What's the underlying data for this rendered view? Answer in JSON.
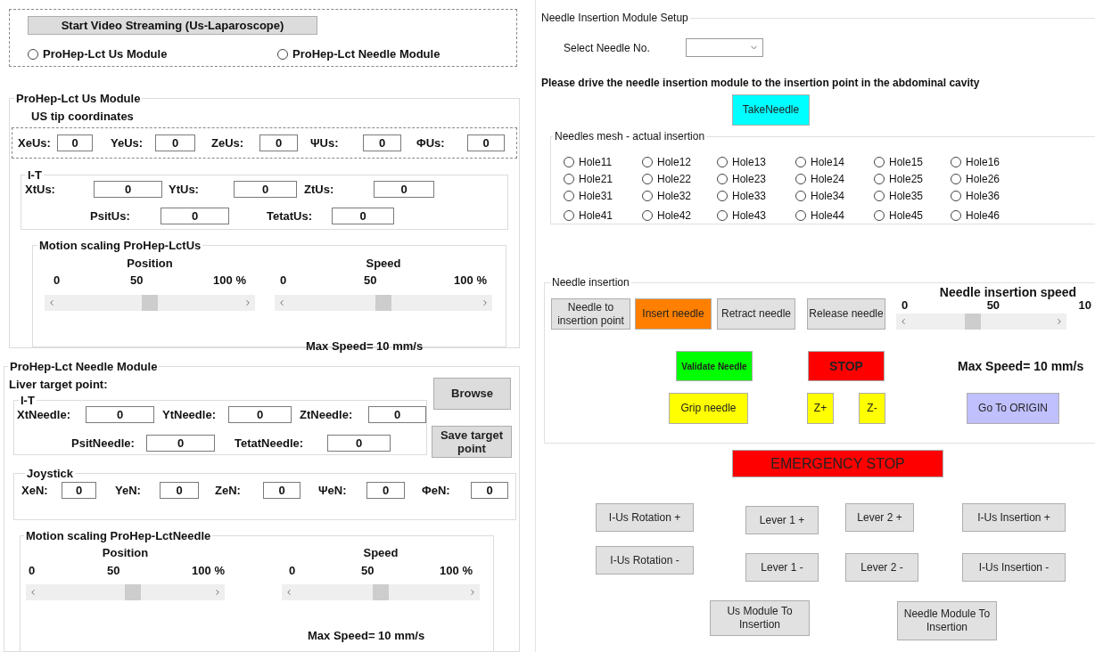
{
  "video_panel": {
    "stream_button": "Start Video  Streaming (Us-Laparoscope)",
    "modules": [
      {
        "label": "ProHep-Lct Us Module",
        "selected": false
      },
      {
        "label": "ProHep-Lct Needle Module",
        "selected": false
      }
    ]
  },
  "us_module": {
    "title": "ProHep-Lct Us Module",
    "tip_title": "US tip coordinates",
    "tip_fields": [
      {
        "label": "XeUs:",
        "value": "0"
      },
      {
        "label": "YeUs:",
        "value": "0"
      },
      {
        "label": "ZeUs:",
        "value": "0"
      },
      {
        "label": "ΨUs:",
        "value": "0"
      },
      {
        "label": "ΦUs:",
        "value": "0"
      }
    ],
    "it_group": {
      "title": "I-T",
      "fields": [
        {
          "label": "XtUs:",
          "value": "0"
        },
        {
          "label": "YtUs:",
          "value": "0"
        },
        {
          "label": "ZtUs:",
          "value": "0"
        },
        {
          "label": "PsitUs:",
          "value": "0"
        },
        {
          "label": "TetatUs:",
          "value": "0"
        }
      ]
    },
    "motion": {
      "title": "Motion scaling ProHep-LctUs",
      "sliders": [
        {
          "title": "Position",
          "ticks": [
            "0",
            "50",
            "100 %"
          ],
          "level": 0.5
        },
        {
          "title": "Speed",
          "ticks": [
            "0",
            "50",
            "100 %"
          ],
          "level": 0.5
        }
      ],
      "max_speed": "Max Speed= 10 mm/s"
    }
  },
  "needle_module": {
    "title": "ProHep-Lct Needle Module",
    "target_title": "Liver target point:",
    "it_group": {
      "title": "I-T",
      "fields": [
        {
          "label": "XtNeedle:",
          "value": "0"
        },
        {
          "label": "YtNeedle:",
          "value": "0"
        },
        {
          "label": "ZtNeedle:",
          "value": "0"
        },
        {
          "label": "PsitNeedle:",
          "value": "0"
        },
        {
          "label": "TetatNeedle:",
          "value": "0"
        }
      ]
    },
    "buttons": [
      "Browse",
      "Save target point"
    ],
    "joystick": {
      "title": "Joystick",
      "fields": [
        {
          "label": "XeN:",
          "value": "0"
        },
        {
          "label": "YeN:",
          "value": "0"
        },
        {
          "label": "ZeN:",
          "value": "0"
        },
        {
          "label": "ΨeN:",
          "value": "0"
        },
        {
          "label": "ΦeN:",
          "value": "0"
        }
      ]
    },
    "motion": {
      "title": "Motion scaling ProHep-LctNeedle",
      "sliders": [
        {
          "title": "Position",
          "ticks": [
            "0",
            "50",
            "100 %"
          ],
          "level": 0.54
        },
        {
          "title": "Speed",
          "ticks": [
            "0",
            "50",
            "100 %"
          ],
          "level": 0.5
        }
      ],
      "max_speed": "Max Speed= 10 mm/s"
    }
  },
  "setup": {
    "title": "Needle Insertion Module Setup",
    "select_label": "Select Needle No.",
    "instruction": "Please drive the needle insertion module to the insertion point in the abdominal cavity",
    "take_button": {
      "label": "TakeNeedle",
      "color": "#00ffff"
    },
    "mesh": {
      "title": "Needles mesh - actual insertion",
      "holes": [
        {
          "label": "Hole11",
          "selected": false
        },
        {
          "label": "Hole12",
          "selected": false
        },
        {
          "label": "Hole13",
          "selected": false
        },
        {
          "label": "Hole14",
          "selected": false
        },
        {
          "label": "Hole15",
          "selected": false
        },
        {
          "label": "Hole16",
          "selected": false
        },
        {
          "label": "Hole21",
          "selected": false
        },
        {
          "label": "Hole22",
          "selected": false
        },
        {
          "label": "Hole23",
          "selected": false
        },
        {
          "label": "Hole24",
          "selected": false
        },
        {
          "label": "Hole25",
          "selected": false
        },
        {
          "label": "Hole26",
          "selected": false
        },
        {
          "label": "Hole31",
          "selected": false
        },
        {
          "label": "Hole32",
          "selected": false
        },
        {
          "label": "Hole33",
          "selected": false
        },
        {
          "label": "Hole34",
          "selected": false
        },
        {
          "label": "Hole35",
          "selected": false
        },
        {
          "label": "Hole36",
          "selected": false
        },
        {
          "label": "Hole41",
          "selected": false
        },
        {
          "label": "Hole42",
          "selected": false
        },
        {
          "label": "Hole43",
          "selected": false
        },
        {
          "label": "Hole44",
          "selected": false
        },
        {
          "label": "Hole45",
          "selected": false
        },
        {
          "label": "Hole46",
          "selected": false
        }
      ]
    }
  },
  "insertion": {
    "title": "Needle insertion",
    "buttons": [
      {
        "label": "Needle to insertion point",
        "color": "#e1e1e1"
      },
      {
        "label": "Insert needle",
        "color": "#ff8000"
      },
      {
        "label": "Retract needle",
        "color": "#e1e1e1"
      },
      {
        "label": "Release needle",
        "color": "#e1e1e1"
      },
      {
        "label": "Validate Needle",
        "color": "#00ff00"
      },
      {
        "label": "STOP",
        "color": "#ff0000"
      },
      {
        "label": "Grip needle",
        "color": "#ffff00"
      },
      {
        "label": "Z+",
        "color": "#ffff00"
      },
      {
        "label": "Z-",
        "color": "#ffff00"
      },
      {
        "label": "Go To ORIGIN",
        "color": "#c0c0ff"
      }
    ],
    "speed_slider": {
      "title": "Needle insertion speed",
      "ticks": [
        "0",
        "50",
        "10"
      ],
      "level": 0.45
    },
    "max_speed": "Max Speed= 10 mm/s"
  },
  "emergency_button": {
    "label": "EMERGENCY STOP",
    "color": "#ff0000"
  },
  "jog_buttons": [
    "I-Us Rotation +",
    "Lever 1 +",
    "Lever 2 +",
    "I-Us Insertion +",
    "I-Us Rotation -",
    "Lever 1 -",
    "Lever 2 -",
    "I-Us Insertion -"
  ],
  "transfer_buttons": [
    "Us Module To Insertion",
    "Needle Module To Insertion"
  ]
}
